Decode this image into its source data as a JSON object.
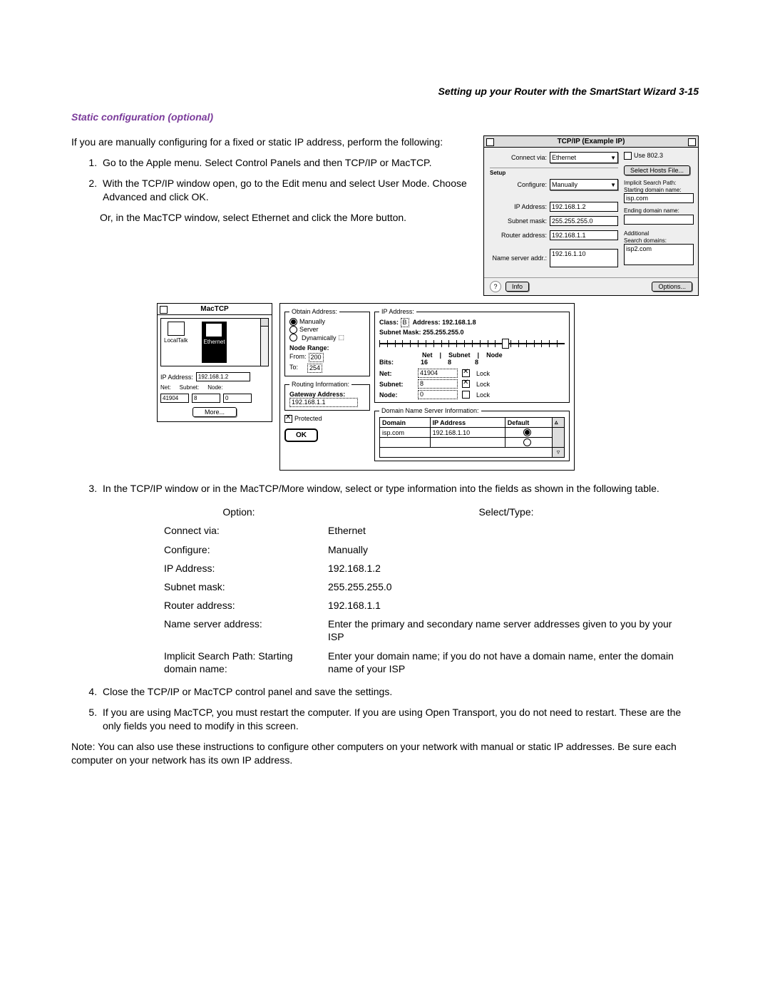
{
  "header": {
    "title": "Setting up your Router with the SmartStart Wizard   3-15"
  },
  "subheading": "Static configuration (optional)",
  "intro": "If you are manually configuring for a fixed or static IP address, perform the following:",
  "step1": "Go to the Apple menu. Select Control Panels and then TCP/IP or MacTCP.",
  "step2": "With the TCP/IP window open, go to the Edit menu and select User Mode. Choose Advanced and click OK.",
  "step2b": "Or, in the MacTCP window, select Ethernet and click the More button.",
  "step3": "In the TCP/IP window or in the MacTCP/More window, select or type information into the fields as shown in the following table.",
  "step4": "Close the TCP/IP or MacTCP control panel and save the settings.",
  "step5": "If you are using MacTCP, you must restart the computer. If you are using Open Transport, you do not need to restart. These are the only fields you need to modify in this screen.",
  "note": "Note: You can also use these instructions to configure other computers on your network with manual or static IP addresses. Be sure each computer on your network has its own IP address.",
  "tcpip_window": {
    "title": "TCP/IP (Example IP)",
    "setup_label": "Setup",
    "connect_via_label": "Connect via:",
    "connect_via_value": "Ethernet",
    "use_8023_label": "Use 802.3",
    "configure_label": "Configure:",
    "configure_value": "Manually",
    "select_hosts_btn": "Select Hosts File...",
    "implicit_label": "Implicit Search Path:",
    "starting_domain_label": "Starting domain name:",
    "starting_domain_value": "isp.com",
    "ip_label": "IP Address:",
    "ip_value": "192.168.1.2",
    "subnet_label": "Subnet mask:",
    "subnet_value": "255.255.255.0",
    "ending_domain_label": "Ending domain name:",
    "router_label": "Router address:",
    "router_value": "192.168.1.1",
    "additional_label": "Additional",
    "search_domains_label": "Search domains:",
    "search_domains_value": "isp2.com",
    "ns_label": "Name server addr.:",
    "ns_value": "192.16.1.10",
    "info_btn": "Info",
    "options_btn": "Options..."
  },
  "mactcp_window": {
    "title": "MacTCP",
    "icon1": "LocalTalk",
    "icon2": "Ethernet",
    "ip_label": "IP Address:",
    "ip_value": "192.168.1.2",
    "net_label": "Net:",
    "subnet_label": "Subnet:",
    "node_label": "Node:",
    "net_val": "41904",
    "subnet_val": "8",
    "node_val": "0",
    "more_btn": "More..."
  },
  "more_window": {
    "obtain_legend": "Obtain Address:",
    "radio_manually": "Manually",
    "radio_server": "Server",
    "radio_dynamic": "Dynamically",
    "node_range_label": "Node Range:",
    "from_label": "From:",
    "from_val": "200",
    "to_label": "To:",
    "to_val": "254",
    "ip_legend": "IP Address:",
    "class_label": "Class:",
    "class_val": "B",
    "address_label": "Address: 192.168.1.8",
    "subnet_mask_label": "Subnet Mask: 255.255.255.0",
    "hdr_net": "Net",
    "hdr_subnet": "Subnet",
    "hdr_node": "Node",
    "bits_label": "Bits:",
    "bits_net": "16",
    "bits_subnet": "8",
    "bits_node": "8",
    "net_label": "Net:",
    "net_val": "41904",
    "subnet_label": "Subnet:",
    "subnet_val": "8",
    "node_label": "Node:",
    "node_val": "0",
    "lock_label": "Lock",
    "routing_legend": "Routing Information:",
    "gateway_label": "Gateway Address:",
    "gateway_val": "192.168.1.1",
    "protected_label": "Protected",
    "dns_legend": "Domain Name Server Information:",
    "dns_h1": "Domain",
    "dns_h2": "IP Address",
    "dns_h3": "Default",
    "dns_domain": "isp.com",
    "dns_ip": "192.168.1.10",
    "ok_btn": "OK"
  },
  "table": {
    "h1": "Option:",
    "h2": "Select/Type:",
    "rows": [
      {
        "option": "Connect via:",
        "value": "Ethernet"
      },
      {
        "option": "Configure:",
        "value": "Manually"
      },
      {
        "option": "IP Address:",
        "value": "192.168.1.2"
      },
      {
        "option": "Subnet mask:",
        "value": "255.255.255.0"
      },
      {
        "option": "Router address:",
        "value": "192.168.1.1"
      },
      {
        "option": "Name server address:",
        "value": "Enter the primary and secondary name server addresses given to you by your ISP"
      },
      {
        "option": "Implicit Search Path: Starting domain name:",
        "value": "Enter your domain name; if you do not have a domain name, enter the domain name of your ISP"
      }
    ]
  }
}
